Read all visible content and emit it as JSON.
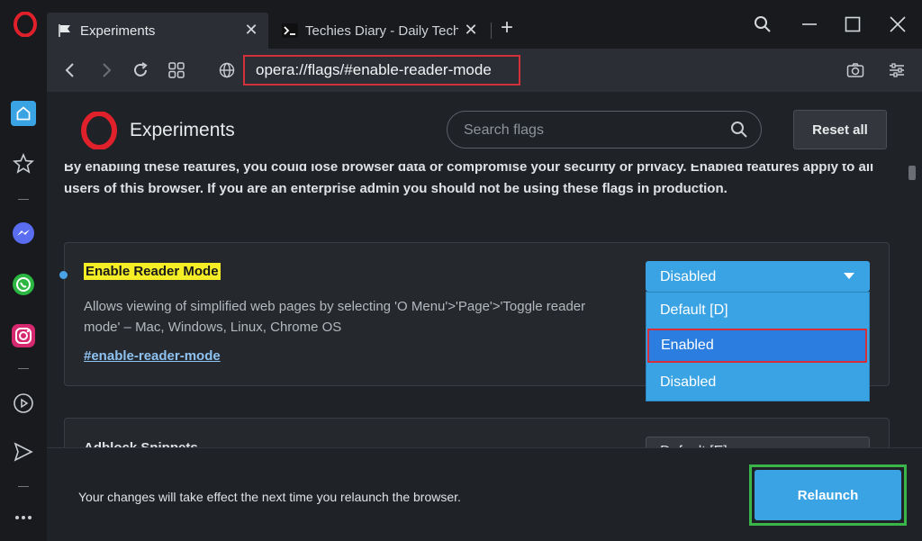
{
  "tabs": [
    {
      "title": "Experiments",
      "icon": "flag-icon"
    },
    {
      "title": "Techies Diary - Daily Tech S",
      "icon": "terminal-icon"
    }
  ],
  "address": {
    "url": "opera://flags/#enable-reader-mode"
  },
  "page": {
    "title": "Experiments",
    "search_placeholder": "Search flags",
    "reset_label": "Reset all",
    "warning": "By enabling these features, you could lose browser data or compromise your security or privacy. Enabled features apply to all users of this browser. If you are an enterprise admin you should not be using these flags in production."
  },
  "flags": [
    {
      "name": "Enable Reader Mode",
      "description": "Allows viewing of simplified web pages by selecting 'O Menu'>'Page'>'Toggle reader mode' – Mac, Windows, Linux, Chrome OS",
      "link": "#enable-reader-mode",
      "selected": "Disabled",
      "options": [
        "Default [D]",
        "Enabled",
        "Disabled"
      ],
      "highlighted_option": "Enabled"
    },
    {
      "name": "Adblock Snippets",
      "selected": "Default [E]"
    }
  ],
  "bottom": {
    "message": "Your changes will take effect the next time you relaunch the browser.",
    "relaunch_label": "Relaunch"
  },
  "colors": {
    "accent": "#3aa3e3",
    "highlight_border": "#d4303a",
    "relaunch_frame": "#3ab54a",
    "flag_highlight": "#f5ee27"
  }
}
